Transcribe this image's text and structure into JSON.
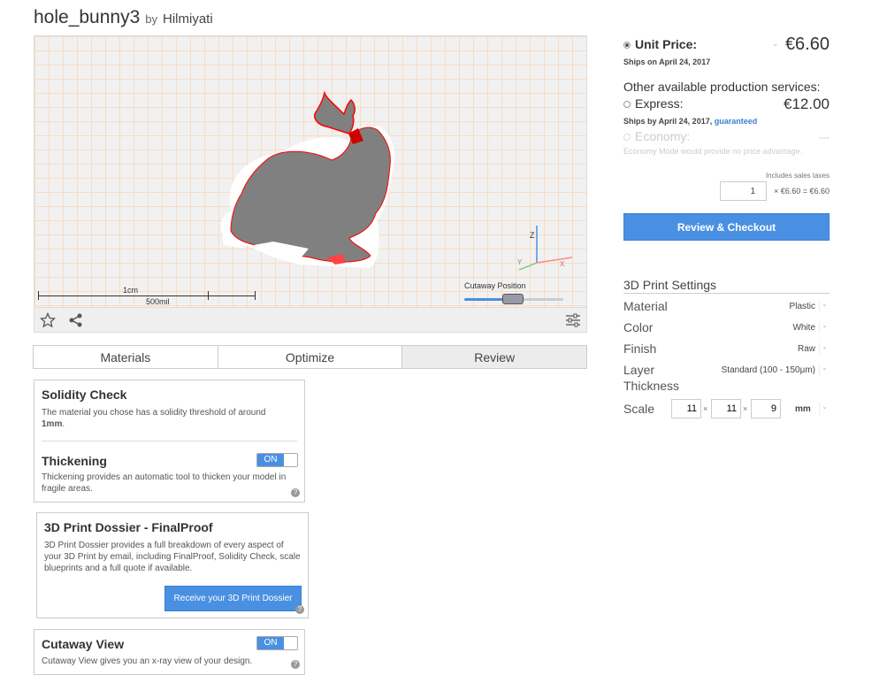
{
  "header": {
    "model_name": "hole_bunny3",
    "by_label": "by",
    "author": "Hilmiyati"
  },
  "viewer": {
    "scale_cm": "1cm",
    "scale_mil": "500mil",
    "axis_z": "Z",
    "axis_y": "Y",
    "axis_x": "X",
    "cutaway_label": "Cutaway Position",
    "cutaway_position": 0.49
  },
  "tabs": [
    {
      "label": "Materials",
      "active": false
    },
    {
      "label": "Optimize",
      "active": false
    },
    {
      "label": "Review",
      "active": true
    }
  ],
  "solidity": {
    "title": "Solidity Check",
    "text": "The material you chose has a solidity threshold of around",
    "threshold": "1mm",
    "threshold_suffix": "."
  },
  "thickening": {
    "title": "Thickening",
    "toggle": "ON",
    "text": "Thickening provides an automatic tool to thicken your model in fragile areas."
  },
  "dossier": {
    "title": "3D Print Dossier - FinalProof",
    "text": "3D Print Dossier provides a full breakdown of every aspect of your 3D Print by email, including FinalProof, Solidity Check, scale blueprints and a full quote if available.",
    "button": "Receive your 3D Print Dossier"
  },
  "cutaway_view": {
    "title": "Cutaway View",
    "toggle": "ON",
    "text": "Cutaway View gives you an x-ray view of your design."
  },
  "pricing": {
    "unit_label": "Unit Price:",
    "unit_price": "€6.60",
    "unit_ships": "Ships on April 24, 2017",
    "other_title": "Other available production services:",
    "express_label": "Express:",
    "express_price": "€12.00",
    "express_ships": "Ships by April 24, 2017,",
    "express_guaranteed": "guaranteed",
    "economy_label": "Economy:",
    "economy_price": "---",
    "economy_note": "Economy Mode would provide no price advantage.",
    "tax_note": "Includes sales taxes",
    "quantity": "1",
    "quantity_formula": "× €6.60 = €6.60",
    "checkout_button": "Review & Checkout"
  },
  "settings": {
    "title": "3D Print Settings",
    "material_label": "Material",
    "material_value": "Plastic",
    "color_label": "Color",
    "color_value": "White",
    "finish_label": "Finish",
    "finish_value": "Raw",
    "layer_label": "Layer Thickness",
    "layer_value": "Standard (100 - 150µm)",
    "scale_label": "Scale",
    "scale_x": "11",
    "scale_y": "11",
    "scale_z": "9",
    "times": "×",
    "unit": "mm"
  },
  "colors": {
    "accent": "#4a90e2",
    "model_fill": "#808080",
    "model_edge": "#ff0000",
    "grid_line": "#f7dcc4"
  }
}
